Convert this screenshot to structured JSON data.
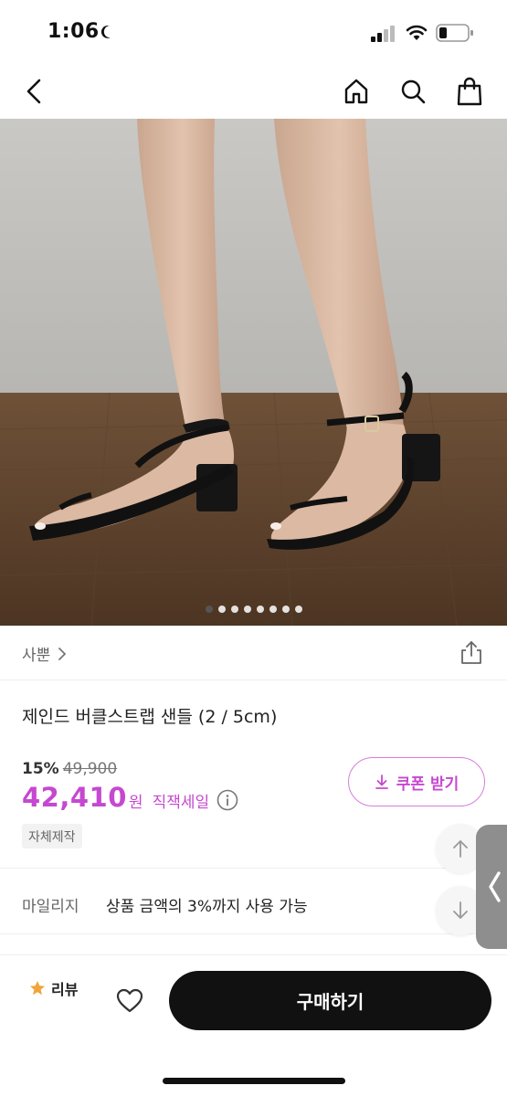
{
  "status_bar": {
    "time": "1:06",
    "icons": [
      "moon-icon",
      "signal-icon",
      "wifi-icon",
      "battery-icon"
    ]
  },
  "nav": {
    "icons": [
      "back-icon",
      "home-icon",
      "search-icon",
      "shopping-bag-icon"
    ]
  },
  "gallery": {
    "total_images": 8,
    "current_index": 1
  },
  "brand": {
    "name": "사뿐",
    "chevron": "chevron-right-icon",
    "share_icon": "share-icon"
  },
  "product": {
    "title": "제인드 버클스트랩 샌들 (2 / 5cm)",
    "discount_percent": "15%",
    "original_price": "49,900",
    "sale_price": "42,410",
    "currency_unit": "원",
    "sale_type": "직잭세일",
    "tag": "자체제작"
  },
  "coupon": {
    "label": "쿠폰 받기",
    "icon": "download-icon"
  },
  "mileage": {
    "label": "마일리지",
    "description": "상품 금액의 3%까지 사용 가능"
  },
  "bottom_bar": {
    "review_label": "리뷰",
    "buy_label": "구매하기"
  },
  "colors": {
    "accent": "#c648d0",
    "buy_button": "#111111",
    "star": "#f0a43a"
  }
}
